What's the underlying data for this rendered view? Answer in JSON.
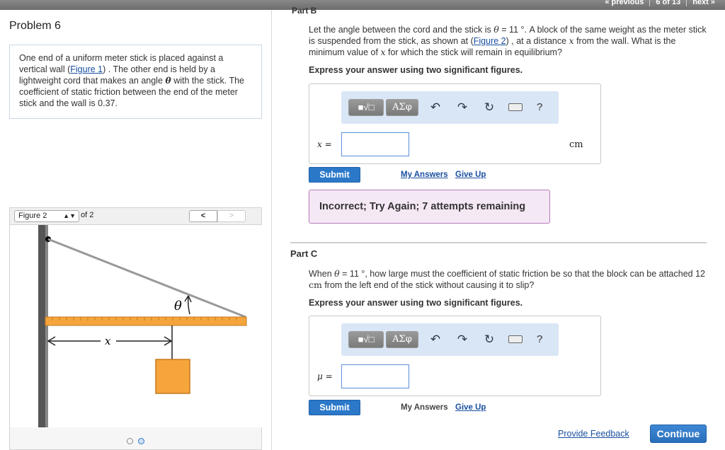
{
  "topnav": {
    "previous": "« previous",
    "counter": "6 of 13",
    "next": "next »"
  },
  "problem": {
    "title": "Problem 6",
    "intro_before": "One end of a uniform meter stick is placed against a vertical wall (",
    "intro_link": "Figure 1",
    "intro_mid1": ") . The other end is held by a lightweight cord that makes an angle ",
    "intro_theta": "θ",
    "intro_after": " with the stick. The coefficient of static friction between the end of the meter stick and the wall is 0.37."
  },
  "figure": {
    "select_label": "Figure 2",
    "of_label": "of 2",
    "prev": "<",
    "next": ">",
    "theta": "θ",
    "x": "x"
  },
  "part_b": {
    "cut_title": "Part B",
    "q_1": "Let the angle between the cord and the stick is ",
    "q_theta": "θ",
    "q_2": " = 11 °. A block of the same weight as the meter stick is suspended from the stick, as shown at (",
    "q_link": "Figure 2",
    "q_3": ") , at a distance ",
    "q_x": "x",
    "q_4": " from the wall. What is the minimum value of ",
    "q_x2": "x",
    "q_5": " for which the stick will remain in equilibrium?",
    "instruction": "Express your answer using two significant figures.",
    "var_label": "x =",
    "unit": "cm",
    "submit": "Submit",
    "my_answers": "My Answers",
    "give_up": "Give Up",
    "feedback": "Incorrect; Try Again; 7 attempts remaining"
  },
  "part_c": {
    "title": "Part C",
    "q_1": "When ",
    "q_theta": "θ",
    "q_2": " = 11 °, how large must the coefficient of static friction be so that the block can be attached 12 ",
    "q_unit": "cm",
    "q_3": " from the left end of the stick without causing it to slip?",
    "instruction": "Express your answer using two significant figures.",
    "var_label": "μ =",
    "submit": "Submit",
    "my_answers": "My Answers",
    "give_up": "Give Up"
  },
  "toolbar": {
    "template_icon": "■√□",
    "greek": "ΑΣφ",
    "undo": "↶",
    "redo": "↷",
    "reset": "↻",
    "help": "?"
  },
  "footer": {
    "provide_feedback": "Provide Feedback",
    "continue": "Continue"
  },
  "colors": {
    "accent": "#2b78c9",
    "stick": "#f6a53c",
    "block": "#f6a53c",
    "feedback_bg": "#f5e8f5"
  }
}
